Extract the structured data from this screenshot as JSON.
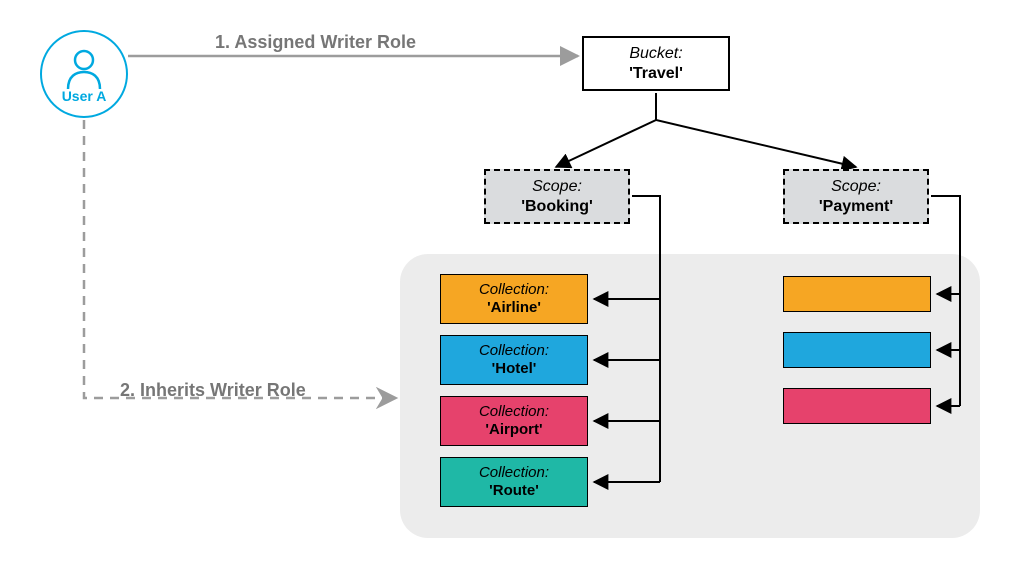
{
  "user": {
    "label": "User A"
  },
  "labels": {
    "assigned": "1. Assigned Writer Role",
    "inherits": "2. Inherits Writer Role"
  },
  "bucket": {
    "type": "Bucket:",
    "name": "'Travel'"
  },
  "scopes": {
    "booking": {
      "type": "Scope:",
      "name": "'Booking'"
    },
    "payment": {
      "type": "Scope:",
      "name": "'Payment'"
    }
  },
  "collections": {
    "airline": {
      "type": "Collection:",
      "name": "'Airline'"
    },
    "hotel": {
      "type": "Collection:",
      "name": "'Hotel'"
    },
    "airport": {
      "type": "Collection:",
      "name": "'Airport'"
    },
    "route": {
      "type": "Collection:",
      "name": "'Route'"
    }
  },
  "colors": {
    "user_accent": "#00A9E0",
    "grey_line": "#9C9C9C",
    "scope_fill": "#DADCDE",
    "tray_fill": "#ECECEC",
    "orange": "#F6A623",
    "blue": "#1FA7DD",
    "pink": "#E6426C",
    "teal": "#1FB8A6"
  }
}
